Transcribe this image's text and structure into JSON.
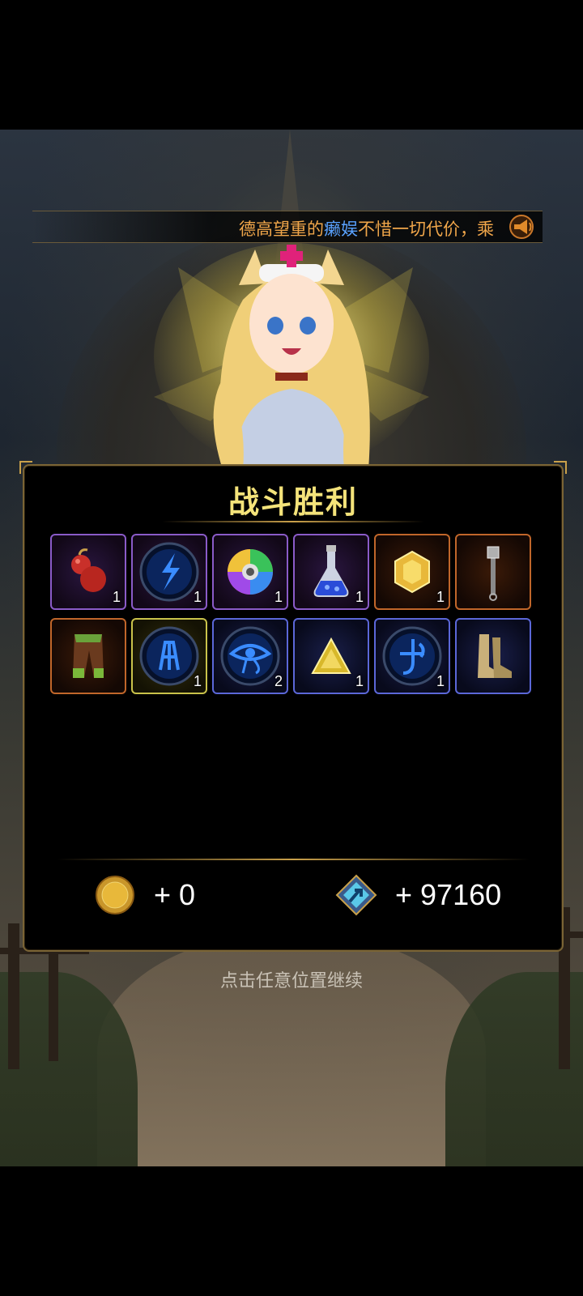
{
  "ticker": {
    "text_before": "德高望重的",
    "name": "癞娱",
    "text_after": "不惜一切代价，乘"
  },
  "panel": {
    "title": "战斗胜利",
    "items": [
      {
        "icon": "red-gourd-icon",
        "rarity": "purple",
        "qty": "1"
      },
      {
        "icon": "blue-rune-orb-icon",
        "rarity": "purple",
        "qty": "1"
      },
      {
        "icon": "rainbow-swirl-orb-icon",
        "rarity": "purple",
        "qty": "1"
      },
      {
        "icon": "blue-potion-flask-icon",
        "rarity": "purple",
        "qty": "1"
      },
      {
        "icon": "gold-gem-icon",
        "rarity": "orange",
        "qty": "1"
      },
      {
        "icon": "iron-staff-icon",
        "rarity": "orange",
        "qty": ""
      },
      {
        "icon": "leather-pants-icon",
        "rarity": "orange",
        "qty": ""
      },
      {
        "icon": "blue-rune-orb-icon",
        "rarity": "yellow",
        "qty": "1"
      },
      {
        "icon": "eye-rune-orb-icon",
        "rarity": "blue",
        "qty": "2"
      },
      {
        "icon": "gold-triangle-gem-icon",
        "rarity": "blue",
        "qty": "1"
      },
      {
        "icon": "blue-rune-orb-icon",
        "rarity": "blue",
        "qty": "1"
      },
      {
        "icon": "leather-boots-icon",
        "rarity": "blue",
        "qty": ""
      }
    ],
    "gold": "+ 0",
    "exp": "+ 97160"
  },
  "hint": "点击任意位置继续",
  "colors": {
    "title": "#f4e37a",
    "ticker": "#f0a64a",
    "ticker_name": "#5aa2ff",
    "rarity_purple": "#8a5bc8",
    "rarity_orange": "#c0662a",
    "rarity_blue": "#5b67d8",
    "rarity_yellow": "#c9c24a"
  }
}
